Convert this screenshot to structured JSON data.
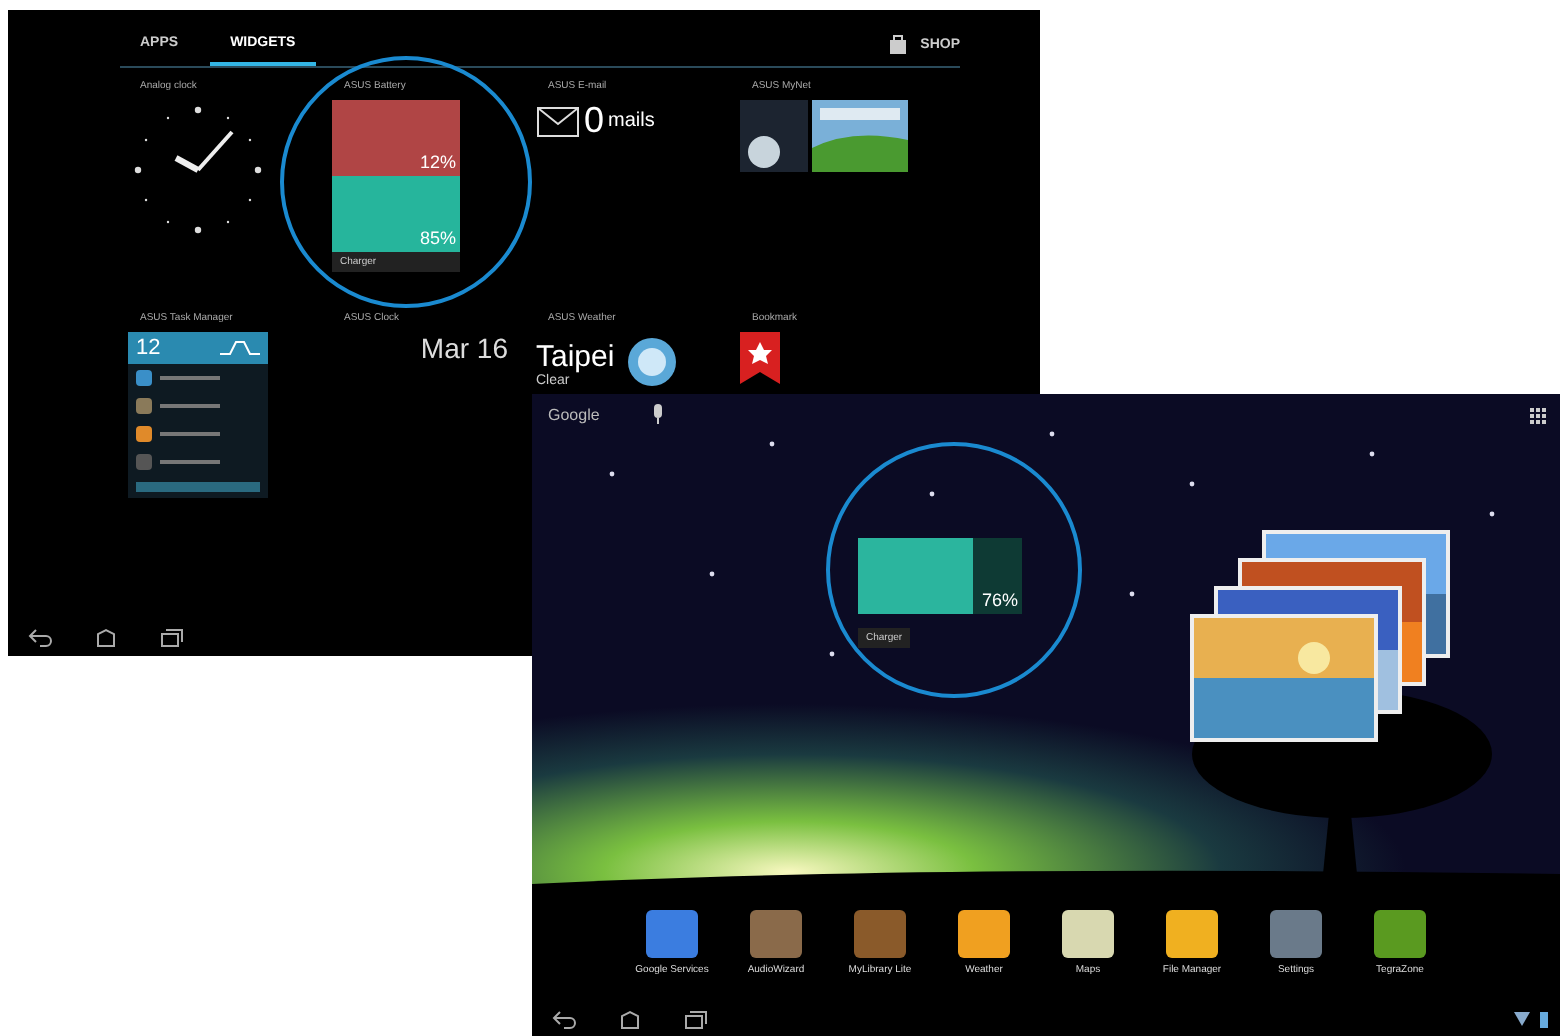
{
  "widget_screen": {
    "tabs": [
      {
        "label": "APPS",
        "selected": false
      },
      {
        "label": "WIDGETS",
        "selected": true
      }
    ],
    "shop": "SHOP",
    "widgets": [
      {
        "kind": "clock",
        "title": "Analog clock"
      },
      {
        "kind": "battery",
        "title": "ASUS Battery",
        "cells": [
          {
            "reading": "12%",
            "color": "#b04545"
          },
          {
            "reading": "85%",
            "color": "#26b59c"
          }
        ],
        "footer": "Charger"
      },
      {
        "kind": "email",
        "title": "ASUS E-mail",
        "count": "0",
        "unit": "mails"
      },
      {
        "kind": "photos",
        "title": "ASUS MyNet"
      },
      {
        "kind": "tasks",
        "title": "ASUS Task Manager",
        "count": "12",
        "rows": [
          {
            "color": "#3a8fc8"
          },
          {
            "color": "#8a7a5a"
          },
          {
            "color": "#e08a2a"
          },
          {
            "color": "#555555"
          }
        ]
      },
      {
        "kind": "date",
        "title": "ASUS Clock",
        "date": "Mar 16"
      },
      {
        "kind": "weather",
        "title": "ASUS Weather",
        "city": "Taipei",
        "condition": "Clear"
      },
      {
        "kind": "bookmark",
        "title": "Bookmark"
      }
    ]
  },
  "home_screen": {
    "search": "Google",
    "battery": {
      "reading": "76%",
      "footer": "Charger"
    },
    "dock": [
      {
        "label": "Google Services",
        "color": "#3b7de0"
      },
      {
        "label": "AudioWizard",
        "color": "#8a6a4a"
      },
      {
        "label": "MyLibrary Lite",
        "color": "#8a5a2a"
      },
      {
        "label": "Weather",
        "color": "#f0a020"
      },
      {
        "label": "Maps",
        "color": "#d8d8b0"
      },
      {
        "label": "File Manager",
        "color": "#f0b020"
      },
      {
        "label": "Settings",
        "color": "#6a7a8a"
      },
      {
        "label": "TegraZone",
        "color": "#5a9a20"
      }
    ]
  }
}
